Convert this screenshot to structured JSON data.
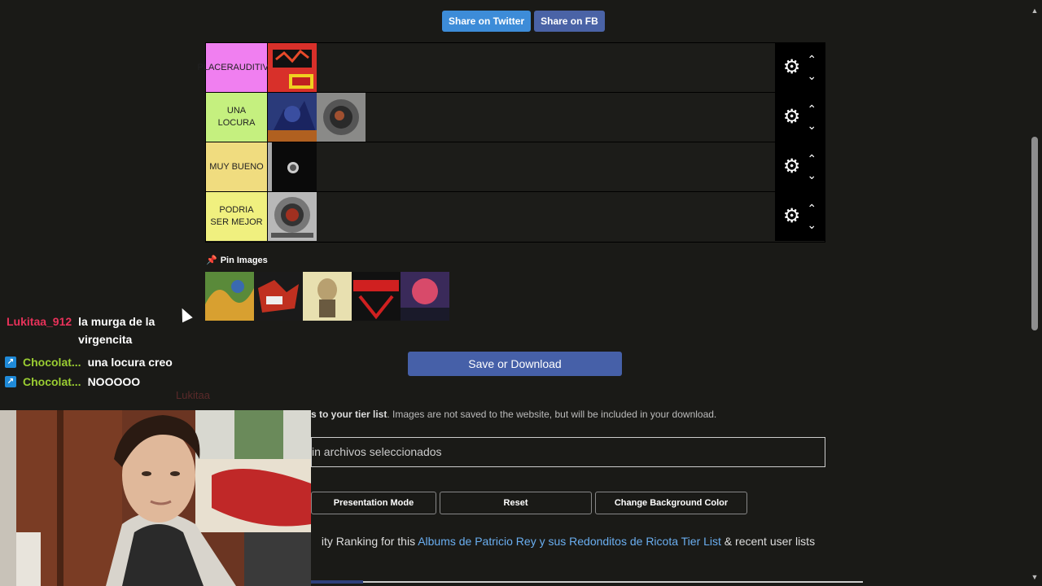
{
  "share": {
    "twitter_label": "Share on Twitter",
    "fb_label": "Share on FB"
  },
  "tiers": [
    {
      "label": "PLACERAUDITIVO",
      "color": "#f07ff0"
    },
    {
      "label": "UNA LOCURA",
      "color": "#c5f07f"
    },
    {
      "label": "MUY BUENO",
      "color": "#f0dc7f"
    },
    {
      "label": "PODRIA SER MEJOR",
      "color": "#f0f07f"
    }
  ],
  "pin": {
    "label": "Pin Images"
  },
  "save": {
    "label": "Save or Download"
  },
  "upload": {
    "bold_text": "s to your tier list",
    "rest_text": ". Images are not saved to the website, but will be included in your download.",
    "file_label": "in archivos seleccionados"
  },
  "buttons": {
    "presentation": "Presentation Mode",
    "reset": "Reset",
    "background": "Change Background Color"
  },
  "community": {
    "prefix": "ity Ranking for this ",
    "link": "Albums de Patricio Rey y sus Redonditos de Ricota Tier List",
    "suffix": " & recent user lists"
  },
  "chat": [
    {
      "user": "Lukitaa_912",
      "user_color": "#e8325a",
      "message": "la murga de la virgencita",
      "badge": ""
    },
    {
      "user": "Chocolat...",
      "user_color": "#9acd32",
      "message": "una locura creo",
      "badge": "↗"
    },
    {
      "user": "Chocolat...",
      "user_color": "#9acd32",
      "message": "NOOOOO",
      "badge": "↗"
    }
  ],
  "chat_faded_user": "Lukitaa"
}
